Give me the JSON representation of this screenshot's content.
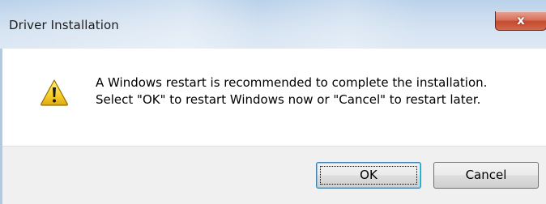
{
  "window": {
    "title": "Driver Installation",
    "close_glyph": "x"
  },
  "dialog": {
    "icon": "warning-icon",
    "message_line1": "A Windows restart is recommended to complete the installation.",
    "message_line2": "Select \"OK\" to restart Windows now or \"Cancel\" to restart later."
  },
  "buttons": {
    "ok_label": "OK",
    "cancel_label": "Cancel"
  },
  "colors": {
    "titlebar": "#c9dbee",
    "close_button": "#c74a2f",
    "warning_fill": "#f5d02a",
    "footer": "#f0f0f0"
  }
}
